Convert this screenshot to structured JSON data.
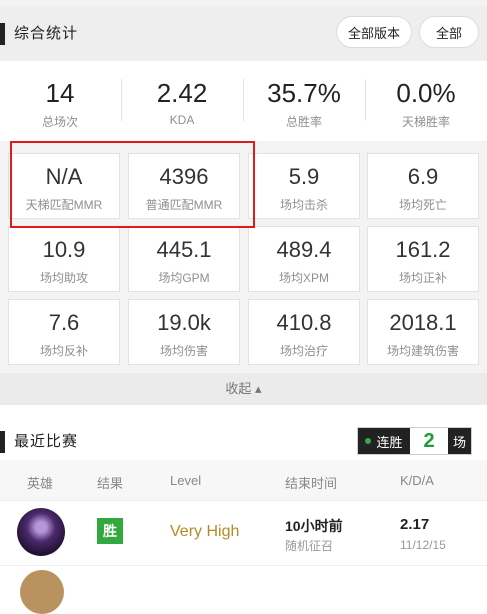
{
  "stats_header": {
    "title": "综合统计",
    "version_button": "全部版本",
    "all_button": "全部"
  },
  "summary": [
    {
      "value": "14",
      "label": "总场次"
    },
    {
      "value": "2.42",
      "label": "KDA"
    },
    {
      "value": "35.7%",
      "label": "总胜率"
    },
    {
      "value": "0.0%",
      "label": "天梯胜率"
    }
  ],
  "cards": [
    {
      "value": "N/A",
      "label": "天梯匹配MMR"
    },
    {
      "value": "4396",
      "label": "普通匹配MMR"
    },
    {
      "value": "5.9",
      "label": "场均击杀"
    },
    {
      "value": "6.9",
      "label": "场均死亡"
    },
    {
      "value": "10.9",
      "label": "场均助攻"
    },
    {
      "value": "445.1",
      "label": "场均GPM"
    },
    {
      "value": "489.4",
      "label": "场均XPM"
    },
    {
      "value": "161.2",
      "label": "场均正补"
    },
    {
      "value": "7.6",
      "label": "场均反补"
    },
    {
      "value": "19.0k",
      "label": "场均伤害"
    },
    {
      "value": "410.8",
      "label": "场均治疗"
    },
    {
      "value": "2018.1",
      "label": "场均建筑伤害"
    }
  ],
  "collapse_label": "收起 ▴",
  "recent": {
    "title": "最近比赛",
    "streak_label": "连胜",
    "streak_count": "2",
    "streak_unit": "场",
    "columns": [
      "英雄",
      "结果",
      "Level",
      "结束时间",
      "K/D/A"
    ],
    "matches": [
      {
        "result": "胜",
        "level": "Very High",
        "end_time": "10小时前",
        "mode": "随机征召",
        "kda": "2.17",
        "date": "11/12/15"
      }
    ]
  },
  "colors": {
    "win": "#33a83f",
    "level": "#b58a26",
    "highlight": "#e01b1b",
    "dark": "#222222"
  }
}
